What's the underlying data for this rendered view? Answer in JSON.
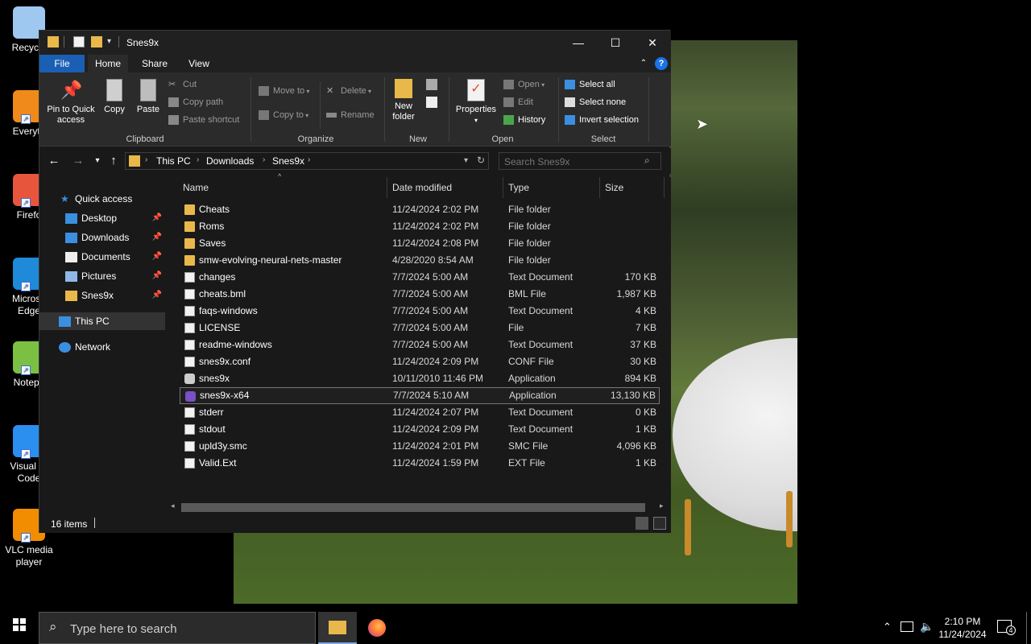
{
  "desktop": {
    "icons": [
      {
        "label": "Recycle",
        "color": "#9ec8f0"
      },
      {
        "label": "Everyth",
        "color": "#f08a1a"
      },
      {
        "label": "Firefo",
        "color": "#e8553d"
      },
      {
        "label": "Microso\nEdge",
        "color": "#1e8ad8"
      },
      {
        "label": "Notepa",
        "color": "#7bc043"
      },
      {
        "label": "Visual St\nCode",
        "color": "#2b8ff0"
      },
      {
        "label": "VLC media\nplayer",
        "color": "#f28c00"
      }
    ]
  },
  "window": {
    "title": "Snes9x",
    "controls": {
      "minimize": "—",
      "maximize": "☐",
      "close": "✕"
    }
  },
  "ribbon": {
    "tabs": {
      "file": "File",
      "home": "Home",
      "share": "Share",
      "view": "View"
    },
    "clipboard": {
      "pin": "Pin to Quick\naccess",
      "copy": "Copy",
      "paste": "Paste",
      "cut": "Cut",
      "copy_path": "Copy path",
      "paste_shortcut": "Paste shortcut",
      "group": "Clipboard"
    },
    "organize": {
      "move_to": "Move to",
      "copy_to": "Copy to",
      "delete": "Delete",
      "rename": "Rename",
      "group": "Organize"
    },
    "new": {
      "new_folder": "New\nfolder",
      "group": "New"
    },
    "open": {
      "properties": "Properties",
      "open": "Open",
      "edit": "Edit",
      "history": "History",
      "group": "Open"
    },
    "select": {
      "select_all": "Select all",
      "select_none": "Select none",
      "invert": "Invert selection",
      "group": "Select"
    }
  },
  "address": {
    "crumbs": [
      "This PC",
      "Downloads",
      "Snes9x"
    ],
    "search_placeholder": "Search Snes9x"
  },
  "navpane": {
    "quick_access": "Quick access",
    "pinned": [
      "Desktop",
      "Downloads",
      "Documents",
      "Pictures",
      "Snes9x"
    ],
    "this_pc": "This PC",
    "network": "Network"
  },
  "columns": {
    "name": "Name",
    "date": "Date modified",
    "type": "Type",
    "size": "Size"
  },
  "files": [
    {
      "name": "Cheats",
      "date": "11/24/2024 2:02 PM",
      "type": "File folder",
      "size": "",
      "kind": "folder"
    },
    {
      "name": "Roms",
      "date": "11/24/2024 2:02 PM",
      "type": "File folder",
      "size": "",
      "kind": "folder"
    },
    {
      "name": "Saves",
      "date": "11/24/2024 2:08 PM",
      "type": "File folder",
      "size": "",
      "kind": "folder"
    },
    {
      "name": "smw-evolving-neural-nets-master",
      "date": "4/28/2020 8:54 AM",
      "type": "File folder",
      "size": "",
      "kind": "folder"
    },
    {
      "name": "changes",
      "date": "7/7/2024 5:00 AM",
      "type": "Text Document",
      "size": "170 KB",
      "kind": "doc"
    },
    {
      "name": "cheats.bml",
      "date": "7/7/2024 5:00 AM",
      "type": "BML File",
      "size": "1,987 KB",
      "kind": "doc"
    },
    {
      "name": "faqs-windows",
      "date": "7/7/2024 5:00 AM",
      "type": "Text Document",
      "size": "4 KB",
      "kind": "doc"
    },
    {
      "name": "LICENSE",
      "date": "7/7/2024 5:00 AM",
      "type": "File",
      "size": "7 KB",
      "kind": "doc"
    },
    {
      "name": "readme-windows",
      "date": "7/7/2024 5:00 AM",
      "type": "Text Document",
      "size": "37 KB",
      "kind": "doc"
    },
    {
      "name": "snes9x.conf",
      "date": "11/24/2024 2:09 PM",
      "type": "CONF File",
      "size": "30 KB",
      "kind": "doc"
    },
    {
      "name": "snes9x",
      "date": "10/11/2010 11:46 PM",
      "type": "Application",
      "size": "894 KB",
      "kind": "app"
    },
    {
      "name": "snes9x-x64",
      "date": "7/7/2024 5:10 AM",
      "type": "Application",
      "size": "13,130 KB",
      "kind": "app2"
    },
    {
      "name": "stderr",
      "date": "11/24/2024 2:07 PM",
      "type": "Text Document",
      "size": "0 KB",
      "kind": "doc"
    },
    {
      "name": "stdout",
      "date": "11/24/2024 2:09 PM",
      "type": "Text Document",
      "size": "1 KB",
      "kind": "doc"
    },
    {
      "name": "upld3y.smc",
      "date": "11/24/2024 2:01 PM",
      "type": "SMC File",
      "size": "4,096 KB",
      "kind": "doc"
    },
    {
      "name": "Valid.Ext",
      "date": "11/24/2024 1:59 PM",
      "type": "EXT File",
      "size": "1 KB",
      "kind": "doc"
    }
  ],
  "selected_file_index": 11,
  "status": {
    "count": "16 items"
  },
  "taskbar": {
    "search_placeholder": "Type here to search",
    "time": "2:10 PM",
    "date": "11/24/2024",
    "notification_count": "4"
  },
  "colors": {
    "accent": "#1a5fb4",
    "folder": "#e8b84a",
    "window_bg": "#191919",
    "ribbon_bg": "#2b2b2b"
  }
}
